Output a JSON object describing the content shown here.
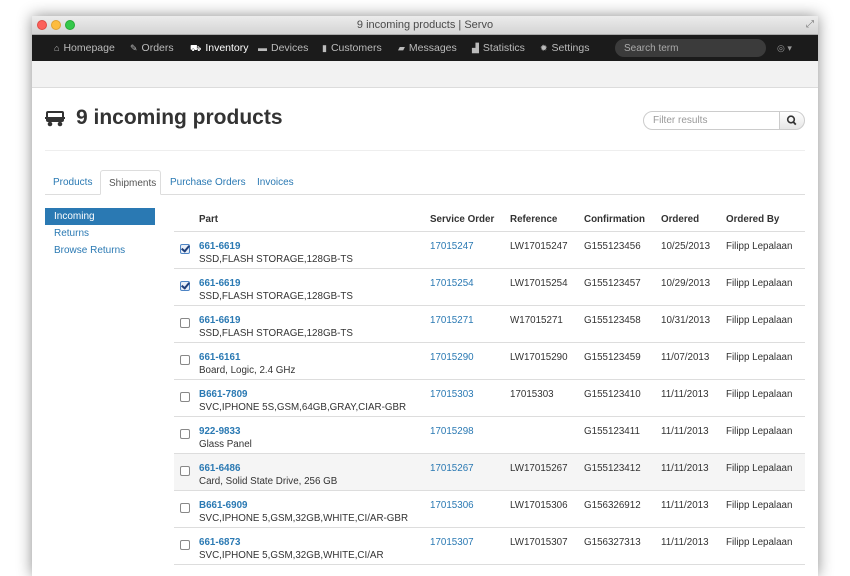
{
  "window": {
    "title": "9 incoming products | Servo"
  },
  "nav": {
    "items": [
      {
        "label": "Homepage",
        "icon": "home-icon"
      },
      {
        "label": "Orders",
        "icon": "wrench-icon"
      },
      {
        "label": "Inventory",
        "icon": "cart-icon",
        "active": true
      },
      {
        "label": "Devices",
        "icon": "laptop-icon"
      },
      {
        "label": "Customers",
        "icon": "book-icon"
      },
      {
        "label": "Messages",
        "icon": "chat-icon"
      },
      {
        "label": "Statistics",
        "icon": "bar-chart-icon"
      },
      {
        "label": "Settings",
        "icon": "gear-icon"
      }
    ],
    "search_placeholder": "Search term",
    "user_menu": "◎ ▾"
  },
  "page": {
    "title": "9 incoming products",
    "filter_placeholder": "Filter results"
  },
  "tabs": [
    "Products",
    "Shipments",
    "Purchase Orders",
    "Invoices"
  ],
  "active_tab": "Shipments",
  "sidebar": {
    "items": [
      "Incoming",
      "Returns",
      "Browse Returns"
    ],
    "active": "Incoming"
  },
  "table": {
    "columns": [
      "Part",
      "Service Order",
      "Reference",
      "Confirmation",
      "Ordered",
      "Ordered By"
    ],
    "rows": [
      {
        "checked": true,
        "part": "661-6619",
        "desc": "SSD,FLASH STORAGE,128GB-TS",
        "service_order": "17015247",
        "reference": "LW17015247",
        "confirmation": "G155123456",
        "ordered": "10/25/2013",
        "ordered_by": "Filipp Lepalaan"
      },
      {
        "checked": true,
        "part": "661-6619",
        "desc": "SSD,FLASH STORAGE,128GB-TS",
        "service_order": "17015254",
        "reference": "LW17015254",
        "confirmation": "G155123457",
        "ordered": "10/29/2013",
        "ordered_by": "Filipp Lepalaan"
      },
      {
        "checked": false,
        "part": "661-6619",
        "desc": "SSD,FLASH STORAGE,128GB-TS",
        "service_order": "17015271",
        "reference": "W17015271",
        "confirmation": "G155123458",
        "ordered": "10/31/2013",
        "ordered_by": "Filipp Lepalaan"
      },
      {
        "checked": false,
        "part": "661-6161",
        "desc": "Board, Logic, 2.4 GHz",
        "service_order": "17015290",
        "reference": "LW17015290",
        "confirmation": "G155123459",
        "ordered": "11/07/2013",
        "ordered_by": "Filipp Lepalaan"
      },
      {
        "checked": false,
        "part": "B661-7809",
        "desc": "SVC,IPHONE 5S,GSM,64GB,GRAY,CIAR-GBR",
        "service_order": "17015303",
        "reference": "17015303",
        "confirmation": "G155123410",
        "ordered": "11/11/2013",
        "ordered_by": "Filipp Lepalaan"
      },
      {
        "checked": false,
        "part": "922-9833",
        "desc": "Glass Panel",
        "service_order": "17015298",
        "reference": "",
        "confirmation": "G155123411",
        "ordered": "11/11/2013",
        "ordered_by": "Filipp Lepalaan"
      },
      {
        "checked": false,
        "highlight": true,
        "part": "661-6486",
        "desc": "Card, Solid State Drive, 256 GB",
        "service_order": "17015267",
        "reference": "LW17015267",
        "confirmation": "G155123412",
        "ordered": "11/11/2013",
        "ordered_by": "Filipp Lepalaan"
      },
      {
        "checked": false,
        "part": "B661-6909",
        "desc": "SVC,IPHONE 5,GSM,32GB,WHITE,CI/AR-GBR",
        "service_order": "17015306",
        "reference": "LW17015306",
        "confirmation": "G156326912",
        "ordered": "11/11/2013",
        "ordered_by": "Filipp Lepalaan"
      },
      {
        "checked": false,
        "part": "661-6873",
        "desc": "SVC,IPHONE 5,GSM,32GB,WHITE,CI/AR",
        "service_order": "17015307",
        "reference": "LW17015307",
        "confirmation": "G156327313",
        "ordered": "11/11/2013",
        "ordered_by": "Filipp Lepalaan"
      }
    ]
  },
  "colors": {
    "link": "#2a79b3",
    "navbar": "#1b1b1b",
    "active_side": "#2a79b3"
  }
}
